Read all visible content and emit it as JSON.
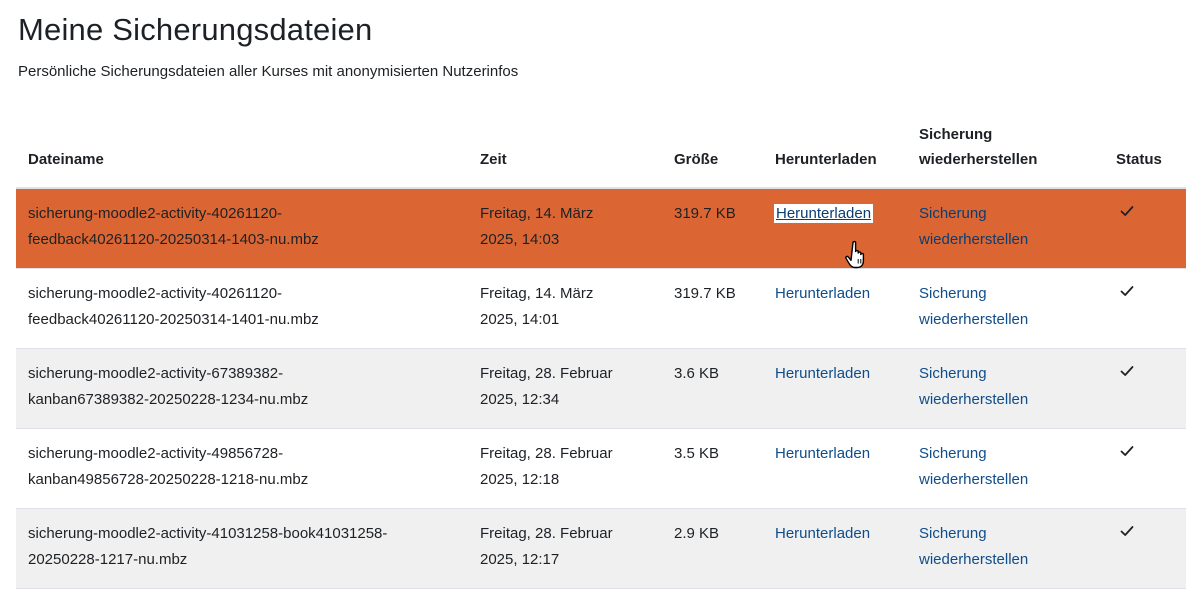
{
  "page": {
    "title": "Meine Sicherungsdateien",
    "subtitle": "Persönliche Sicherungsdateien aller Kurses mit anonymisierten Nutzerinfos"
  },
  "table": {
    "headers": {
      "filename": "Dateiname",
      "time": "Zeit",
      "size": "Größe",
      "download": "Herunterladen",
      "restore_line1": "Sicherung",
      "restore_line2": "wiederherstellen",
      "status": "Status"
    },
    "rows": [
      {
        "filename_line1": "sicherung-moodle2-activity-40261120-",
        "filename_line2": "feedback40261120-20250314-1403-nu.mbz",
        "time_line1": "Freitag, 14. März",
        "time_line2": "2025, 14:03",
        "size": "319.7 KB",
        "download": "Herunterladen",
        "restore_line1": "Sicherung",
        "restore_line2": "wiederherstellen",
        "status_icon": "check-icon"
      },
      {
        "filename_line1": "sicherung-moodle2-activity-40261120-",
        "filename_line2": "feedback40261120-20250314-1401-nu.mbz",
        "time_line1": "Freitag, 14. März",
        "time_line2": "2025, 14:01",
        "size": "319.7 KB",
        "download": "Herunterladen",
        "restore_line1": "Sicherung",
        "restore_line2": "wiederherstellen",
        "status_icon": "check-icon"
      },
      {
        "filename_line1": "sicherung-moodle2-activity-67389382-",
        "filename_line2": "kanban67389382-20250228-1234-nu.mbz",
        "time_line1": "Freitag, 28. Februar",
        "time_line2": "2025, 12:34",
        "size": "3.6 KB",
        "download": "Herunterladen",
        "restore_line1": "Sicherung",
        "restore_line2": "wiederherstellen",
        "status_icon": "check-icon"
      },
      {
        "filename_line1": "sicherung-moodle2-activity-49856728-",
        "filename_line2": "kanban49856728-20250228-1218-nu.mbz",
        "time_line1": "Freitag, 28. Februar",
        "time_line2": "2025, 12:18",
        "size": "3.5 KB",
        "download": "Herunterladen",
        "restore_line1": "Sicherung",
        "restore_line2": "wiederherstellen",
        "status_icon": "check-icon"
      },
      {
        "filename_line1": "sicherung-moodle2-activity-41031258-book41031258-",
        "filename_line2": "20250228-1217-nu.mbz",
        "time_line1": "Freitag, 28. Februar",
        "time_line2": "2025, 12:17",
        "size": "2.9 KB",
        "download": "Herunterladen",
        "restore_line1": "Sicherung",
        "restore_line2": "wiederherstellen",
        "status_icon": "check-icon"
      }
    ]
  },
  "colors": {
    "hover_row": "#dc6633",
    "striped_row": "#f0f0f0",
    "link": "#0f4d8a",
    "text": "#1d2125"
  },
  "cursor": {
    "icon": "hand-pointer-icon"
  }
}
